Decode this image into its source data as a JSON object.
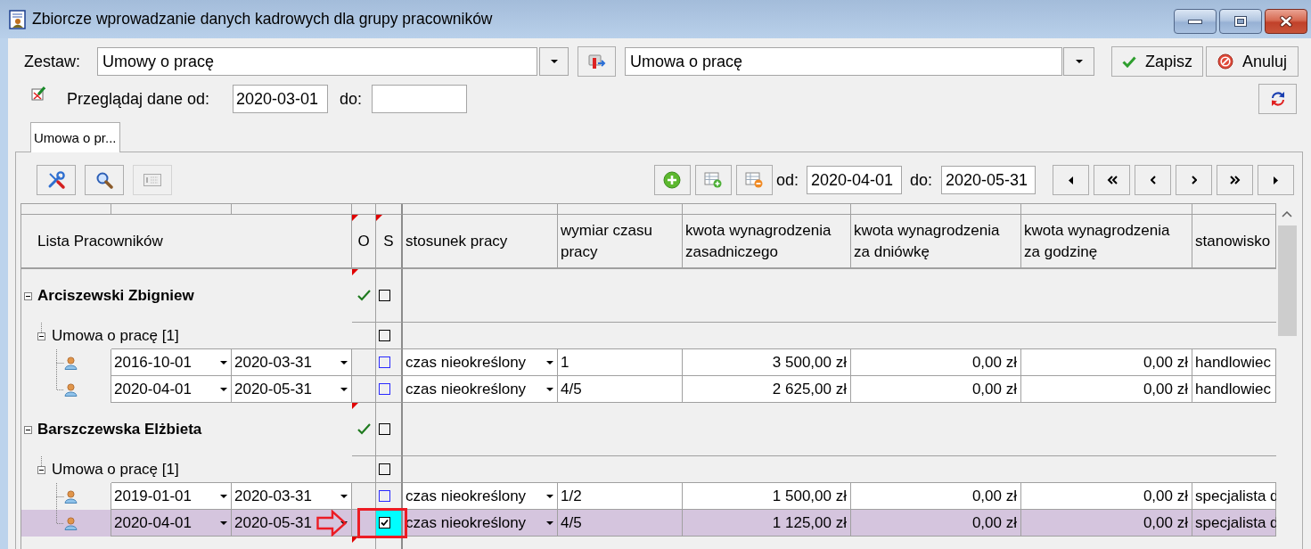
{
  "window": {
    "title": "Zbiorcze wprowadzanie danych kadrowych dla grupy pracowników"
  },
  "form": {
    "set_label": "Zestaw:",
    "set_value": "Umowy o pracę",
    "definition_value": "Umowa o pracę",
    "actions": [
      {
        "kind": "save",
        "label": "Zapisz"
      },
      {
        "kind": "cancel",
        "label": "Anuluj"
      }
    ],
    "browse_label": "Przeglądaj dane od:",
    "browse_from": "2020-03-01",
    "browse_to_label": "do:"
  },
  "tabs": [
    {
      "label": "Umowa o pr...",
      "selected": true
    }
  ],
  "toolbar": {
    "tool_buttons": [
      {
        "kind": "tools",
        "disabled": false
      },
      {
        "kind": "search",
        "disabled": false
      },
      {
        "kind": "card",
        "disabled": true
      }
    ],
    "from_label": "od:",
    "from": "2020-04-01",
    "to_label": "do:",
    "to": "2020-05-31"
  },
  "grid": {
    "columns": [
      {
        "label": "Lista Pracowników",
        "marked": false
      },
      {
        "label": "O",
        "marked": true
      },
      {
        "label": "S",
        "marked": true
      },
      {
        "label": "stosunek pracy",
        "marked": false
      },
      {
        "label": "wymiar czasu pracy",
        "marked": false
      },
      {
        "label": "kwota wynagrodzenia zasadniczego",
        "marked": false
      },
      {
        "label": "kwota wynagrodzenia za dniówkę",
        "marked": false
      },
      {
        "label": "kwota wynagrodzenia za godzinę",
        "marked": false
      },
      {
        "label": "stanowisko",
        "marked": false
      }
    ],
    "employees": [
      {
        "name": "Arciszewski Zbigniew",
        "expanded": true,
        "marked": true,
        "o_checked": true,
        "s_checked": false,
        "children": [
          {
            "name": "Umowa o pracę [1]",
            "expanded": true,
            "s_checked": false,
            "children": [
              {
                "from": "2016-10-01",
                "to": "2020-03-31",
                "s_checked": false,
                "relation": "czas nieokreślony",
                "fraction": "1",
                "base_pay": "3 500,00 zł",
                "daily_pay": "0,00 zł",
                "hourly_pay": "0,00 zł",
                "position": "handlowiec",
                "selected": false,
                "highlighted": false
              },
              {
                "from": "2020-04-01",
                "to": "2020-05-31",
                "s_checked": false,
                "relation": "czas nieokreślony",
                "fraction": "4/5",
                "base_pay": "2 625,00 zł",
                "daily_pay": "0,00 zł",
                "hourly_pay": "0,00 zł",
                "position": "handlowiec",
                "selected": false,
                "highlighted": false
              }
            ]
          }
        ]
      },
      {
        "name": "Barszczewska Elżbieta",
        "expanded": true,
        "marked": true,
        "o_checked": true,
        "s_checked": false,
        "children": [
          {
            "name": "Umowa o pracę [1]",
            "expanded": true,
            "s_checked": false,
            "children": [
              {
                "from": "2019-01-01",
                "to": "2020-03-31",
                "s_checked": false,
                "relation": "czas nieokreślony",
                "fraction": "1/2",
                "base_pay": "1 500,00 zł",
                "daily_pay": "0,00 zł",
                "hourly_pay": "0,00 zł",
                "position": "specjalista d",
                "selected": false,
                "highlighted": false
              },
              {
                "from": "2020-04-01",
                "to": "2020-05-31",
                "s_checked": true,
                "relation": "czas nieokreślony",
                "fraction": "4/5",
                "base_pay": "1 125,00 zł",
                "daily_pay": "0,00 zł",
                "hourly_pay": "0,00 zł",
                "position": "specjalista d",
                "selected": true,
                "highlighted": true
              }
            ]
          }
        ]
      },
      {
        "marked": true
      }
    ]
  }
}
